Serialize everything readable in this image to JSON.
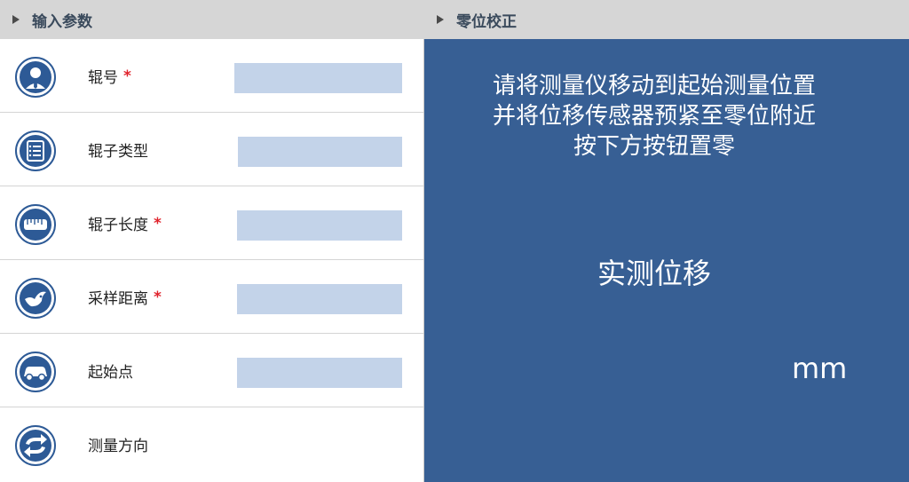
{
  "sections": {
    "input_params": "输入参数",
    "zero_calibration": "零位校正"
  },
  "form": {
    "rows": [
      {
        "label": "辊号",
        "required": "*",
        "icon": "person-icon",
        "value": ""
      },
      {
        "label": "辊子类型",
        "required": "",
        "icon": "list-icon",
        "value": ""
      },
      {
        "label": "辊子长度",
        "required": "*",
        "icon": "ruler-icon",
        "value": ""
      },
      {
        "label": "采样距离",
        "required": "*",
        "icon": "bird-icon",
        "value": ""
      },
      {
        "label": "起始点",
        "required": "",
        "icon": "vehicle-icon",
        "value": ""
      },
      {
        "label": "测量方向",
        "required": "",
        "icon": "direction-arrow-icon",
        "value": ""
      }
    ]
  },
  "zero_panel": {
    "instruction_lines": [
      "请将测量仪移动到起始测量位置",
      "并将位移传感器预紧至零位附近",
      "按下方按钮置零"
    ],
    "measure_label": "实测位移",
    "unit": "mm"
  },
  "colors": {
    "header_bg": "#d6d6d6",
    "panel_blue": "#375f94",
    "field_bg": "#c3d3e9",
    "icon_blue": "#2d5a96",
    "required_red": "#e0232c"
  }
}
